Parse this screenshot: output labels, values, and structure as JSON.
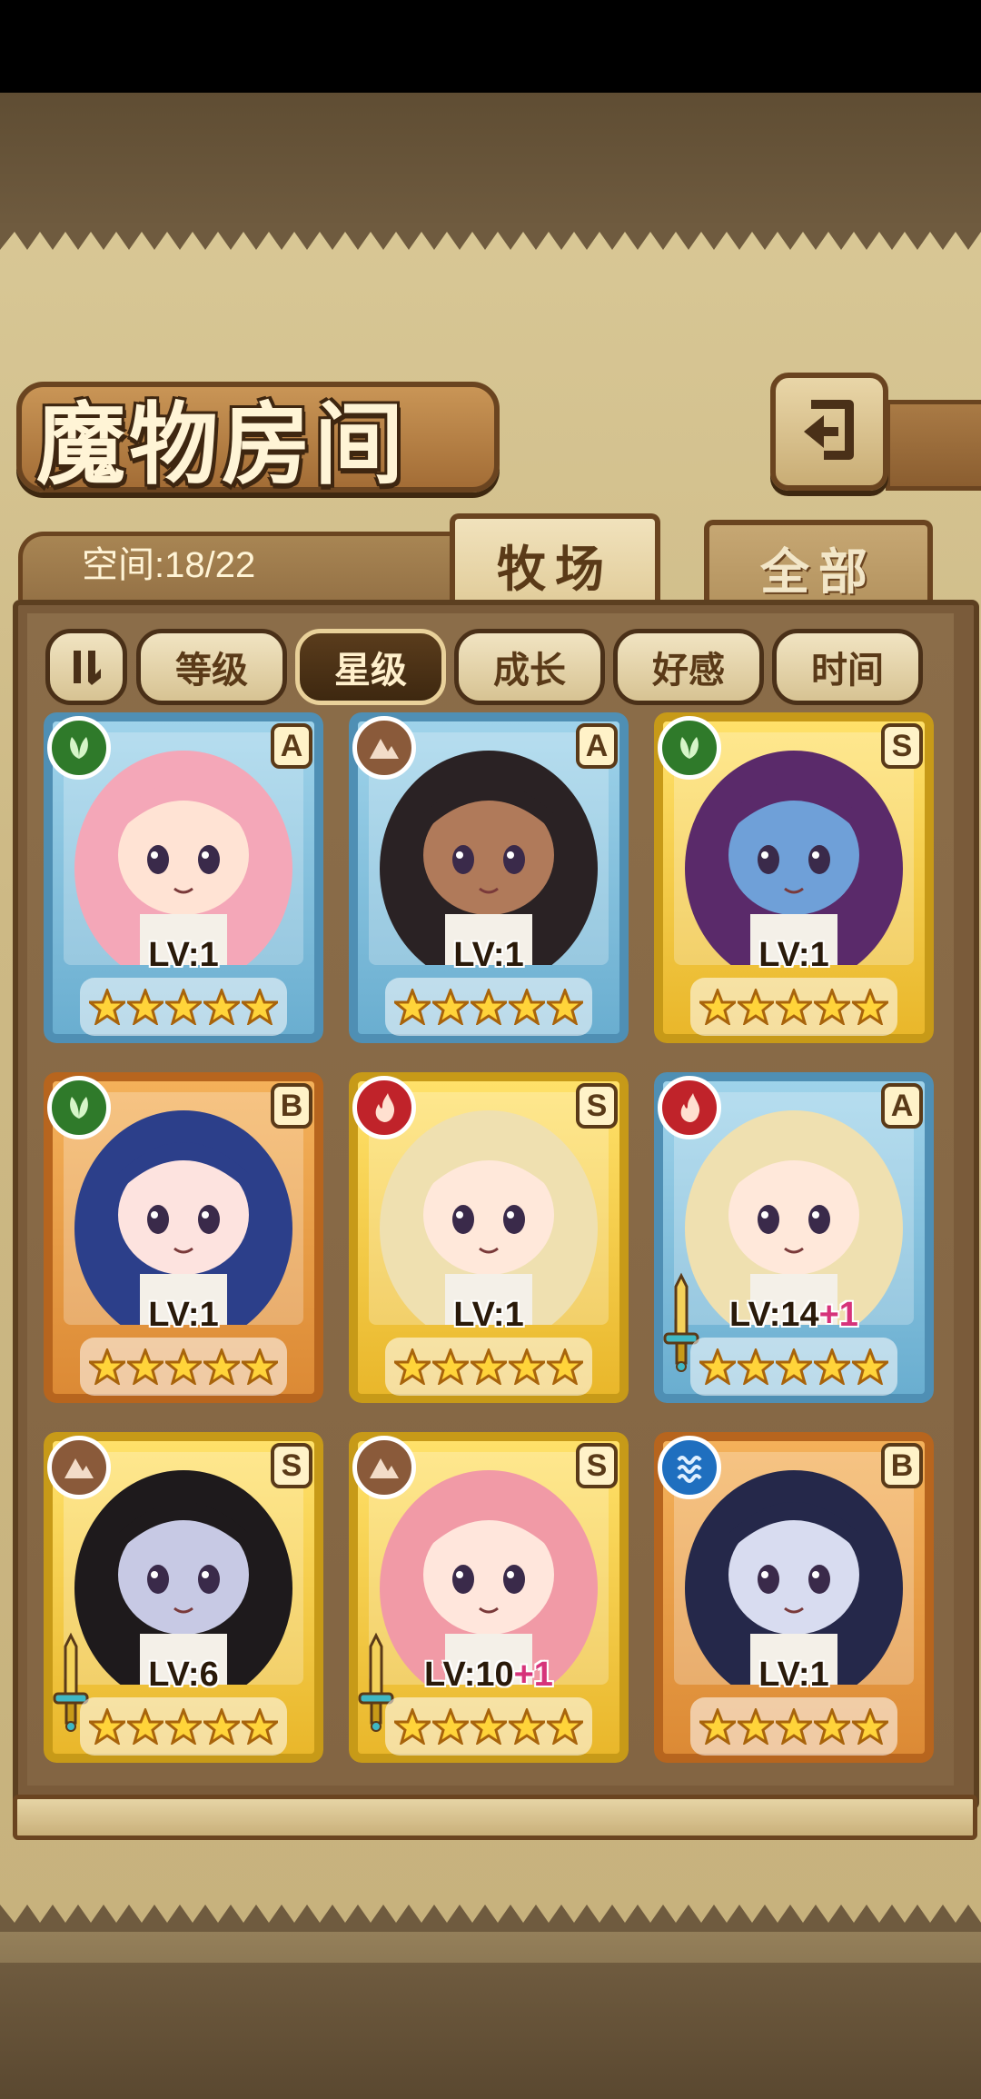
{
  "title": "魔物房间",
  "space": {
    "label": "空间:18/22"
  },
  "tabs": [
    {
      "label": "牧场",
      "active": true
    },
    {
      "label": "全部",
      "active": false
    }
  ],
  "sort_buttons": [
    {
      "label": "等级",
      "selected": false
    },
    {
      "label": "星级",
      "selected": true
    },
    {
      "label": "成长",
      "selected": false
    },
    {
      "label": "好感",
      "selected": false
    },
    {
      "label": "时间",
      "selected": false
    }
  ],
  "cards": [
    {
      "frame": "blue",
      "element": "nature",
      "element_color": "#2f7a2a",
      "rank": "A",
      "level": "LV:1",
      "bonus": "",
      "stars": 5,
      "weapon": false,
      "hair": "#f4a7b8",
      "skin": "#ffe3d4"
    },
    {
      "frame": "blue",
      "element": "earth",
      "element_color": "#8a5a3a",
      "rank": "A",
      "level": "LV:1",
      "bonus": "",
      "stars": 5,
      "weapon": false,
      "hair": "#2a2224",
      "skin": "#b07a5a"
    },
    {
      "frame": "gold",
      "element": "nature",
      "element_color": "#2f7a2a",
      "rank": "S",
      "level": "LV:1",
      "bonus": "",
      "stars": 5,
      "weapon": false,
      "hair": "#5a2a6a",
      "skin": "#6fa0d8"
    },
    {
      "frame": "orange",
      "element": "nature",
      "element_color": "#2f7a2a",
      "rank": "B",
      "level": "LV:1",
      "bonus": "",
      "stars": 5,
      "weapon": false,
      "hair": "#2c3f8a",
      "skin": "#fde3df"
    },
    {
      "frame": "gold",
      "element": "fire",
      "element_color": "#c0232a",
      "rank": "S",
      "level": "LV:1",
      "bonus": "",
      "stars": 5,
      "weapon": false,
      "hair": "#efe0b0",
      "skin": "#ffe8da"
    },
    {
      "frame": "blue",
      "element": "fire",
      "element_color": "#c0232a",
      "rank": "A",
      "level": "LV:14",
      "bonus": "+1",
      "stars": 5,
      "weapon": true,
      "hair": "#efe0b0",
      "skin": "#ffe8da"
    },
    {
      "frame": "gold",
      "element": "earth",
      "element_color": "#8a5a3a",
      "rank": "S",
      "level": "LV:6",
      "bonus": "",
      "stars": 5,
      "weapon": true,
      "hair": "#1e1a1c",
      "skin": "#c7c9e4"
    },
    {
      "frame": "gold",
      "element": "earth",
      "element_color": "#8a5a3a",
      "rank": "S",
      "level": "LV:10",
      "bonus": "+1",
      "stars": 5,
      "weapon": true,
      "hair": "#f19aa6",
      "skin": "#ffe6dc"
    },
    {
      "frame": "orange",
      "element": "water",
      "element_color": "#1f6fbf",
      "rank": "B",
      "level": "LV:1",
      "bonus": "",
      "stars": 5,
      "weapon": false,
      "hair": "#25284a",
      "skin": "#d8dcf0"
    }
  ]
}
